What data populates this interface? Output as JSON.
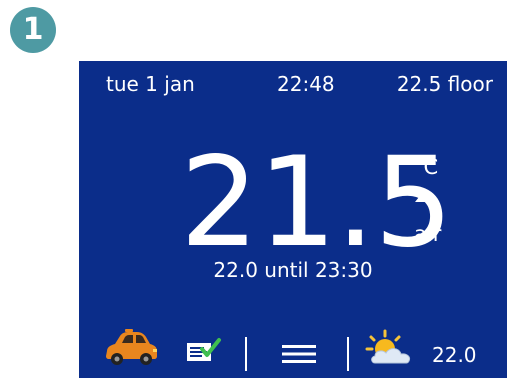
{
  "step": {
    "number": "1"
  },
  "status_bar": {
    "date": "tue 1 jan",
    "time": "22:48",
    "floor": "22.5 floor"
  },
  "main": {
    "temperature": "21.5",
    "unit": "°C",
    "trend": "up",
    "sensor": "air",
    "setpoint": "22.0 until 23:30"
  },
  "bottom_bar": {
    "left_icon": "car-icon",
    "mode_icon": "schedule-check-icon",
    "menu_icon": "menu-icon",
    "weather_icon": "sun-cloud-icon",
    "outdoor_temperature": "22.0"
  },
  "colors": {
    "screen": "#0b2d8a",
    "badge": "#4e9aa3",
    "text": "#ffffff",
    "car": "#e9861e"
  }
}
